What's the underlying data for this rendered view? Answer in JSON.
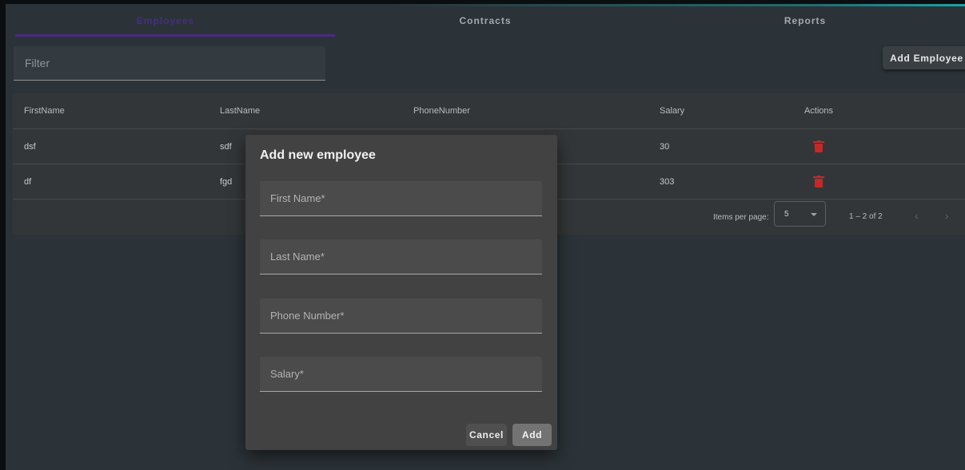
{
  "tabs": [
    {
      "label": "Employees",
      "active": true
    },
    {
      "label": "Contracts",
      "active": false
    },
    {
      "label": "Reports",
      "active": false
    }
  ],
  "filter": {
    "placeholder": "Filter",
    "value": ""
  },
  "toolbar": {
    "add_employee_label": "Add Employee"
  },
  "table": {
    "columns": [
      "FirstName",
      "LastName",
      "PhoneNumber",
      "Salary",
      "Actions"
    ],
    "rows": [
      {
        "first": "dsf",
        "last": "sdf",
        "phone": "",
        "salary": "30",
        "action_icon": "trash-icon"
      },
      {
        "first": "df",
        "last": "fgd",
        "phone": "",
        "salary": "303",
        "action_icon": "trash-icon"
      }
    ]
  },
  "paginator": {
    "items_per_page_label": "Items per page:",
    "page_size": "5",
    "range": "1 – 2 of 2",
    "prev_icon": "‹",
    "next_icon": "›"
  },
  "dialog": {
    "title": "Add new employee",
    "fields": [
      {
        "placeholder": "First Name*"
      },
      {
        "placeholder": "Last Name*"
      },
      {
        "placeholder": "Phone Number*"
      },
      {
        "placeholder": "Salary*"
      }
    ],
    "cancel_label": "Cancel",
    "add_label": "Add"
  },
  "colors": {
    "accent": "#4b2a86",
    "delete": "#c62828",
    "background": "#2b3338",
    "dialog": "#424242"
  }
}
